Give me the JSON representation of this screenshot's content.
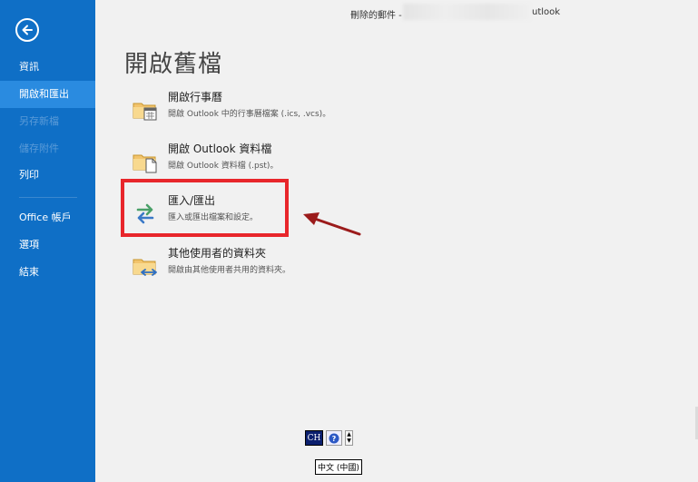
{
  "titlebar": {
    "left_text": "刪除的郵件 -",
    "right_text": "utlook"
  },
  "sidebar": {
    "items": [
      {
        "label": "資訊"
      },
      {
        "label": "開啟和匯出"
      },
      {
        "label": "另存新檔"
      },
      {
        "label": "儲存附件"
      },
      {
        "label": "列印"
      },
      {
        "label": "Office 帳戶"
      },
      {
        "label": "選項"
      },
      {
        "label": "結束"
      }
    ]
  },
  "main": {
    "title": "開啟舊檔",
    "items": [
      {
        "title": "開啟行事曆",
        "desc": "開啟 Outlook 中的行事曆檔案 (.ics, .vcs)。"
      },
      {
        "title": "開啟 Outlook 資料檔",
        "desc": "開啟 Outlook 資料檔 (.pst)。"
      },
      {
        "title": "匯入/匯出",
        "desc": "匯入或匯出檔案和設定。"
      },
      {
        "title": "其他使用者的資料夾",
        "desc": "開啟由其他使用者共用的資料夾。"
      }
    ]
  },
  "ime": {
    "lang": "CH",
    "tooltip": "中文 (中國)"
  },
  "colors": {
    "sidebar": "#0f6fc6",
    "sidebar_active": "#2a8be0",
    "highlight": "#e8262b",
    "arrow": "#9b1b1b"
  }
}
